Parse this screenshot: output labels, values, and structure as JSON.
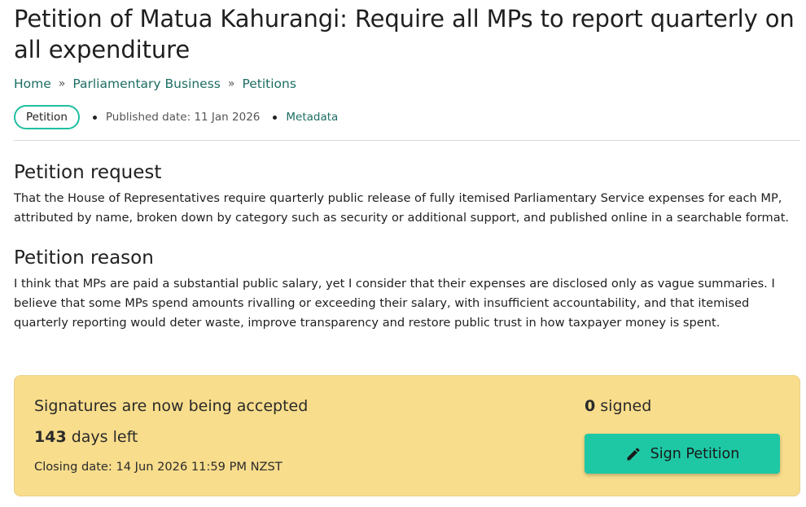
{
  "petition": {
    "title": "Petition of Matua Kahurangi: Require all MPs to report quarterly on all expenditure",
    "breadcrumb": [
      {
        "label": "Home"
      },
      {
        "label": "Parliamentary Business"
      },
      {
        "label": "Petitions"
      }
    ],
    "breadcrumb_separator": "»",
    "badge": "Petition",
    "published": "Published date: 11 Jan 2026",
    "metadata_link": "Metadata",
    "request_heading": "Petition request",
    "request_text": "That the House of Representatives require quarterly public release of fully itemised Parliamentary Service expenses for each MP, attributed by name, broken down by category such as security or additional support, and published online in a searchable format.",
    "reason_heading": "Petition reason",
    "reason_text": "I think that MPs are paid a substantial public salary, yet I consider that their expenses are disclosed only as vague summaries. I believe that some MPs spend amounts rivalling or exceeding their salary, with insufficient accountability, and that itemised quarterly reporting would deter waste, improve transparency and restore public trust in how taxpayer money is spent."
  },
  "signatures": {
    "status": "Signatures are now being accepted",
    "days_count": "143",
    "days_suffix": " days left",
    "closing": "Closing date: 14 Jun 2026 11:59 PM NZST",
    "signed_count": "0",
    "signed_suffix": " signed",
    "button_label": "Sign Petition",
    "button_icon": "pencil-icon"
  },
  "colors": {
    "link": "#1d6e63",
    "accent": "#1fbfa0",
    "button": "#1ec8a5",
    "panel": "#f8dd8c"
  }
}
